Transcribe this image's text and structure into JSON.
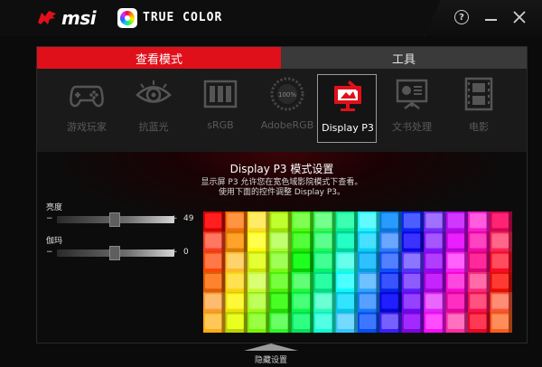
{
  "titlebar": {
    "brand": "msi",
    "app_name": "TRUE COLOR",
    "help_label": "?"
  },
  "tabs": [
    {
      "label": "查看模式"
    },
    {
      "label": "工具"
    }
  ],
  "modes": [
    {
      "label": "游戏玩家",
      "icon": "gamepad-icon"
    },
    {
      "label": "抗蓝光",
      "icon": "eye-icon"
    },
    {
      "label": "sRGB",
      "icon": "srgb-panels-icon"
    },
    {
      "label": "AdobeRGB",
      "icon": "adobergb-gauge-icon",
      "badge": "100%"
    },
    {
      "label": "Display P3",
      "icon": "display-p3-icon",
      "active": true
    },
    {
      "label": "文书处理",
      "icon": "presentation-icon"
    },
    {
      "label": "电影",
      "icon": "film-icon"
    }
  ],
  "panel": {
    "title": "Display P3 模式设置",
    "desc_line1": "显示屏 P3 允许您在宽色域影院模式下查看。",
    "desc_line2": "使用下面的控件调整 Display P3。"
  },
  "sliders": [
    {
      "label": "亮度",
      "minus": "−",
      "plus": "+",
      "value": "49",
      "level": 0.49
    },
    {
      "label": "伽玛",
      "minus": "−",
      "plus": "+",
      "value": "0",
      "level": 0.49
    }
  ],
  "hide_button": {
    "label": "隐藏设置"
  },
  "colors": {
    "accent": "#e0101a",
    "background": "#0b0b0b"
  }
}
